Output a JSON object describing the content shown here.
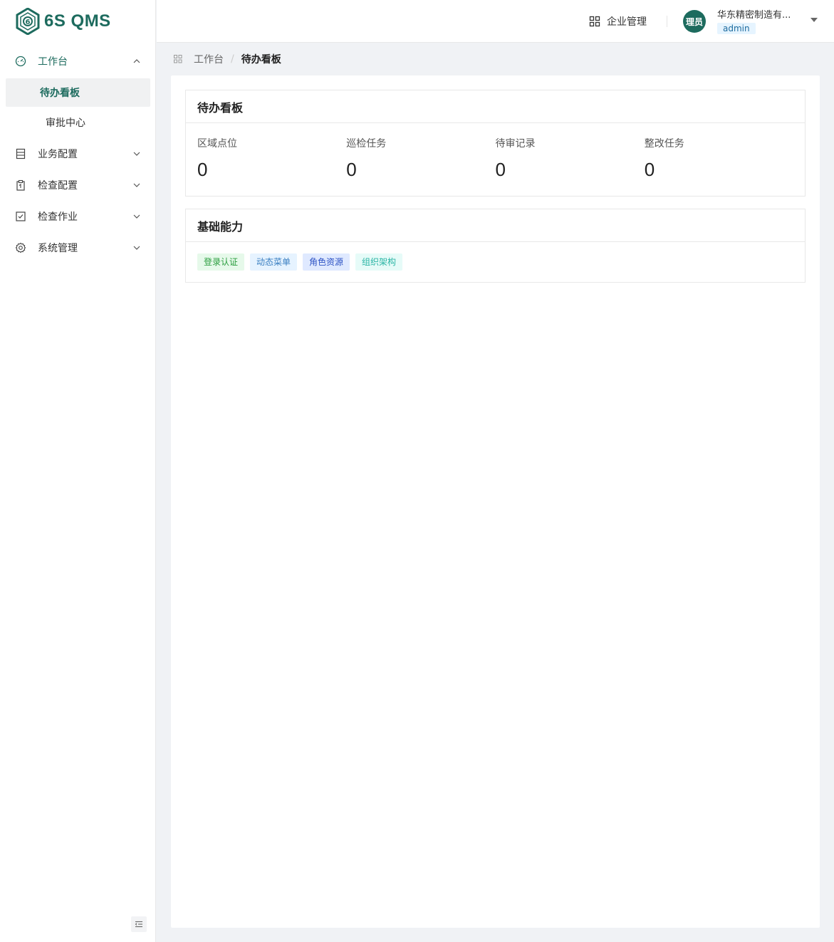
{
  "app": {
    "logo_text": "6S QMS"
  },
  "sidebar": {
    "items": [
      {
        "label": "工作台",
        "icon": "dashboard-icon",
        "open": true,
        "children": [
          {
            "label": "待办看板",
            "active": true
          },
          {
            "label": "审批中心",
            "active": false
          }
        ]
      },
      {
        "label": "业务配置",
        "icon": "business-config-icon",
        "open": false
      },
      {
        "label": "检查配置",
        "icon": "clipboard-icon",
        "open": false
      },
      {
        "label": "检查作业",
        "icon": "checkbox-icon",
        "open": false
      },
      {
        "label": "系统管理",
        "icon": "gear-icon",
        "open": false
      }
    ]
  },
  "header": {
    "enterprise_label": "企业管理",
    "avatar_text": "理员",
    "company": "华东精密制造有...",
    "role": "admin"
  },
  "breadcrumb": {
    "home": "工作台",
    "separator": "/",
    "current": "待办看板"
  },
  "todo_board": {
    "title": "待办看板",
    "stats": [
      {
        "label": "区域点位",
        "value": "0"
      },
      {
        "label": "巡检任务",
        "value": "0"
      },
      {
        "label": "待审记录",
        "value": "0"
      },
      {
        "label": "整改任务",
        "value": "0"
      }
    ]
  },
  "capabilities": {
    "title": "基础能力",
    "tags": [
      "登录认证",
      "动态菜单",
      "角色资源",
      "组织架构"
    ]
  },
  "colors": {
    "primary": "#1d6b5e",
    "background": "#f0f2f5"
  }
}
